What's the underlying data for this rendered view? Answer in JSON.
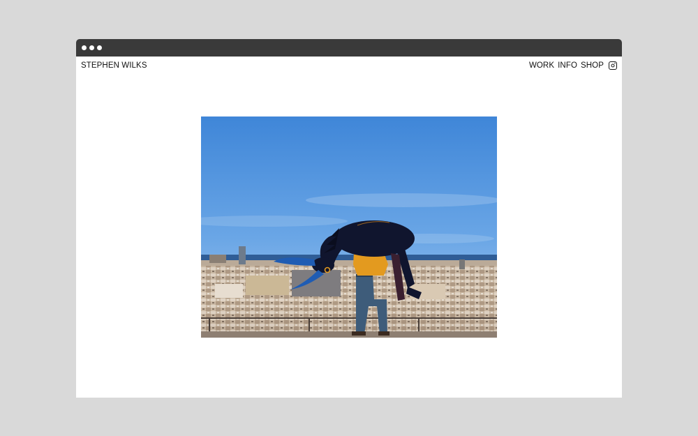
{
  "site": {
    "name": "STEPHEN WILKS"
  },
  "nav": {
    "items": [
      {
        "label": "WORK"
      },
      {
        "label": "INFO"
      },
      {
        "label": "SHOP"
      }
    ],
    "social_icon": "instagram-icon"
  },
  "hero": {
    "icon": "photo-person-carrying-stuffed-donkey-over-city"
  },
  "colors": {
    "page_background": "#d9d9d9",
    "browser_chrome": "#3a3a3a",
    "content_background": "#ffffff",
    "text": "#111111"
  }
}
